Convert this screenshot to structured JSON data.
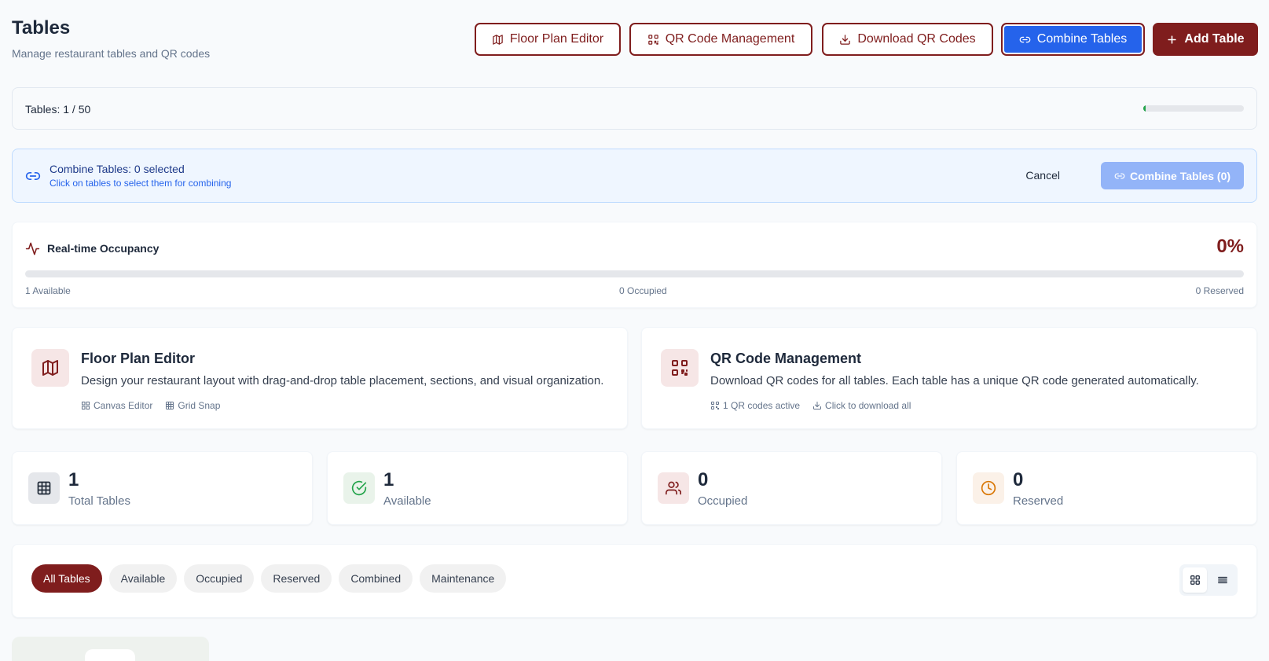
{
  "header": {
    "title": "Tables",
    "subtitle": "Manage restaurant tables and QR codes",
    "buttons": {
      "floor_plan": "Floor Plan Editor",
      "qr_management": "QR Code Management",
      "download_qr": "Download QR Codes",
      "combine": "Combine Tables",
      "add": "Add Table"
    }
  },
  "table_count": {
    "label": "Tables: 1 / 50",
    "used": 1,
    "limit": 50
  },
  "combine_banner": {
    "title": "Combine Tables: 0 selected",
    "subtitle": "Click on tables to select them for combining",
    "cancel": "Cancel",
    "confirm": "Combine Tables (0)"
  },
  "occupancy": {
    "title": "Real-time Occupancy",
    "percent": "0%",
    "available": "1 Available",
    "occupied": "0 Occupied",
    "reserved": "0 Reserved"
  },
  "features": {
    "floor_plan": {
      "title": "Floor Plan Editor",
      "description": "Design your restaurant layout with drag-and-drop table placement, sections, and visual organization.",
      "tag1": "Canvas Editor",
      "tag2": "Grid Snap"
    },
    "qr": {
      "title": "QR Code Management",
      "description": "Download QR codes for all tables. Each table has a unique QR code generated automatically.",
      "tag1": "1 QR codes active",
      "tag2": "Click to download all"
    }
  },
  "stats": {
    "total": {
      "value": "1",
      "label": "Total Tables"
    },
    "available": {
      "value": "1",
      "label": "Available"
    },
    "occupied": {
      "value": "0",
      "label": "Occupied"
    },
    "reserved": {
      "value": "0",
      "label": "Reserved"
    }
  },
  "filters": {
    "all": "All Tables",
    "available": "Available",
    "occupied": "Occupied",
    "reserved": "Reserved",
    "combined": "Combined",
    "maintenance": "Maintenance"
  },
  "colors": {
    "brand": "#7f1d1d",
    "accent_blue": "#2563eb",
    "success": "#22a34a",
    "warning": "#d97706"
  },
  "icons": {
    "floor_plan": "map-icon",
    "qr": "qr-code-icon",
    "download": "download-icon",
    "combine": "link-icon",
    "add": "plus-icon",
    "occupancy": "activity-icon"
  }
}
